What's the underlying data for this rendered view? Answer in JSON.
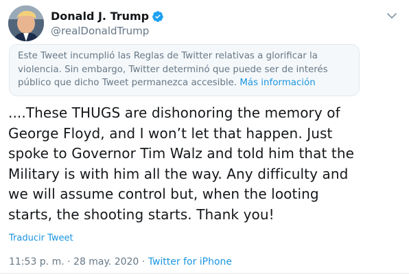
{
  "user": {
    "display_name": "Donald J. Trump",
    "handle": "@realDonaldTrump",
    "verified": true
  },
  "icons": {
    "verified": "verified-badge-icon",
    "more": "chevron-down-icon"
  },
  "notice": {
    "text": "Este Tweet incumplió las Reglas de Twitter relativas a glorificar la violencia. Sin embargo, Twitter determinó que puede ser de interés público que dicho Tweet permanezca accesible.",
    "link": "Más información"
  },
  "tweet": {
    "lines": [
      "....These THUGS are dishonoring the memory of",
      "George Floyd, and I won’t let that happen. Just",
      "spoke to Governor Tim Walz and told him that the",
      "Military is with him all the way. Any difficulty and",
      "we will assume control but, when the looting",
      "starts, the shooting starts. Thank you!"
    ],
    "translate": "Traducir Tweet"
  },
  "meta": {
    "time": "11:53 p. m.",
    "sep1": " · ",
    "date": "28 may. 2020",
    "sep2": " · ",
    "source": "Twitter for iPhone"
  },
  "colors": {
    "link": "#1b95e0",
    "secondary": "#657786",
    "notice_bg": "#f5f8fa"
  }
}
